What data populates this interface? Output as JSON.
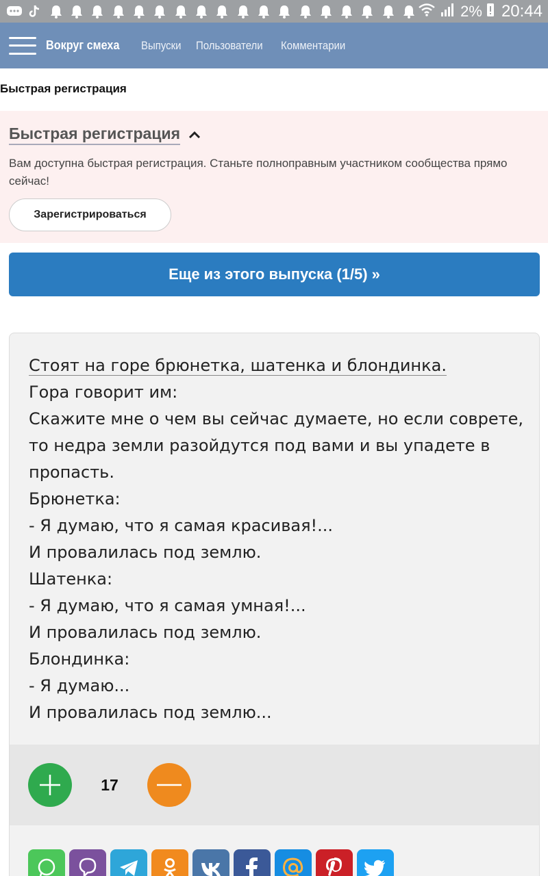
{
  "statusbar": {
    "battery": "2%",
    "time": "20:44",
    "icons": [
      "message-icon",
      "tiktok-icon",
      "bell-icon",
      "wifi-icon",
      "signal-icon",
      "battery-icon"
    ]
  },
  "nav": {
    "brand": "Вокруг смеха",
    "links": [
      "Выпуски",
      "Пользователи",
      "Комментарии"
    ]
  },
  "breadcrumb": "Быстрая регистрация",
  "registration": {
    "title": "Быстрая регистрация",
    "text": "Вам доступна быстрая регистрация. Станьте полноправным участником сообщества прямо сейчас!",
    "button": "Зарегистрироваться"
  },
  "more_button": "Еще из этого выпуска (1/5) »",
  "joke": {
    "lines": [
      "Стоят на горе брюнетка, шатенка и блондинка.",
      "Гора говорит им:",
      "Скажите мне о чем вы сейчас думаете, но если соврете, то недра земли разойдутся под вами и вы упадете в пропасть.",
      "Брюнетка:",
      "- Я думаю, что я самая красивая!...",
      "И провалилась под землю.",
      "Шатенка:",
      "- Я думаю, что я самая умная!...",
      "И провалилась под землю.",
      "Блондинка:",
      "- Я думаю...",
      "И провалилась под землю..."
    ]
  },
  "votes": {
    "score": "17"
  },
  "share": [
    {
      "name": "whatsapp",
      "color": "#4cc75a"
    },
    {
      "name": "viber",
      "color": "#7b519d"
    },
    {
      "name": "telegram",
      "color": "#2ea6d9"
    },
    {
      "name": "odnoklassniki",
      "color": "#f18a1e"
    },
    {
      "name": "vkontakte",
      "color": "#4a76a8"
    },
    {
      "name": "facebook",
      "color": "#3b5998"
    },
    {
      "name": "mailru",
      "color": "#168de2"
    },
    {
      "name": "pinterest",
      "color": "#cb2027"
    },
    {
      "name": "twitter",
      "color": "#1da1f2"
    }
  ]
}
